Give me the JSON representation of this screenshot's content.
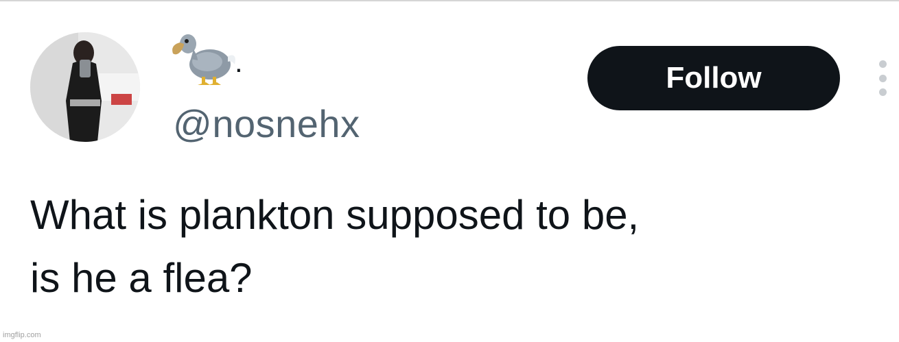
{
  "profile": {
    "avatar_icon": "profile-photo",
    "display_name_emoji": "dodo-bird-emoji",
    "display_name_suffix": ".",
    "handle": "@nosnehx"
  },
  "actions": {
    "follow_label": "Follow",
    "more_icon": "vertical-ellipsis-icon"
  },
  "tweet": {
    "text_line1": "What is plankton supposed to be,",
    "text_line2": "is he a flea?"
  },
  "watermark": "imgflip.com",
  "colors": {
    "text_primary": "#0f1419",
    "text_secondary": "#536471",
    "button_bg": "#0f1419",
    "button_text": "#ffffff"
  }
}
